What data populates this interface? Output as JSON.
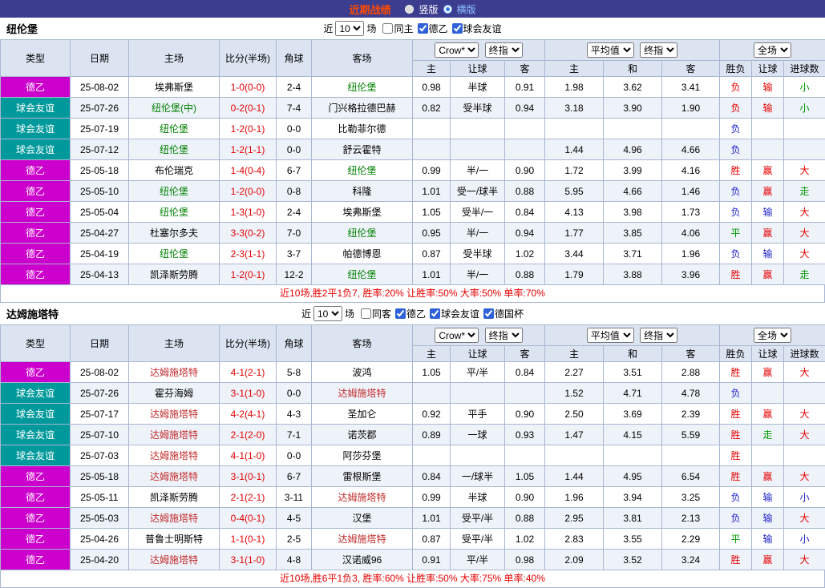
{
  "topbar": {
    "title": "近期战绩",
    "vertical_label": "竖版",
    "horizontal_label": "横版"
  },
  "labels": {
    "near": "近",
    "field": "场"
  },
  "columns": {
    "type": "类型",
    "date": "日期",
    "home": "主场",
    "score": "比分(半场)",
    "corner": "角球",
    "away": "客场",
    "asian_book": "Crow*",
    "asian_final": "终指",
    "asian_home": "主",
    "asian_line": "让球",
    "asian_away": "客",
    "euro_avg": "平均值",
    "euro_final": "终指",
    "euro_home": "主",
    "euro_draw": "和",
    "euro_away": "客",
    "scope": "全场",
    "wdl": "胜负",
    "handicap_result": "让球",
    "goals_result": "进球数"
  },
  "colors": {
    "topbar_bg": "#3d3d8f",
    "title": "#ff4b00",
    "header_bg": "#dce4f2",
    "grid_border": "#aab6d2",
    "row_stripe": "#eef3fa",
    "summary_text": "#e60000"
  },
  "badge_colors": {
    "德乙": "#cc00cc",
    "球会友谊": "#00999b"
  },
  "result_colors": {
    "r": "#e60000",
    "b": "#2222cc",
    "g": "#009900"
  },
  "sections": [
    {
      "team": "纽伦堡",
      "team_color": "#008000",
      "count": "10",
      "filters": [
        {
          "label": "同主",
          "checked": false
        },
        {
          "label": "德乙",
          "checked": true
        },
        {
          "label": "球会友谊",
          "checked": true
        }
      ],
      "rows": [
        {
          "type": "德乙",
          "date": "25-08-02",
          "home": "埃弗斯堡",
          "hh": false,
          "score": "1-0(0-0)",
          "corner": "2-4",
          "away": "纽伦堡",
          "ah": true,
          "a1": "0.98",
          "al": "半球",
          "a2": "0.91",
          "e1": "1.98",
          "ex": "3.62",
          "e2": "3.41",
          "w": "负",
          "wc": "r",
          "h": "输",
          "hc": "r",
          "g": "小",
          "gc": "g"
        },
        {
          "type": "球会友谊",
          "date": "25-07-26",
          "home": "纽伦堡(中)",
          "hh": true,
          "score": "0-2(0-1)",
          "corner": "7-4",
          "away": "门兴格拉德巴赫",
          "ah": false,
          "a1": "0.82",
          "al": "受半球",
          "a2": "0.94",
          "e1": "3.18",
          "ex": "3.90",
          "e2": "1.90",
          "w": "负",
          "wc": "r",
          "h": "输",
          "hc": "r",
          "g": "小",
          "gc": "g"
        },
        {
          "type": "球会友谊",
          "date": "25-07-19",
          "home": "纽伦堡",
          "hh": true,
          "score": "1-2(0-1)",
          "corner": "0-0",
          "away": "比勒菲尔德",
          "ah": false,
          "a1": "",
          "al": "",
          "a2": "",
          "e1": "",
          "ex": "",
          "e2": "",
          "w": "负",
          "wc": "b",
          "h": "",
          "hc": "",
          "g": "",
          "gc": ""
        },
        {
          "type": "球会友谊",
          "date": "25-07-12",
          "home": "纽伦堡",
          "hh": true,
          "score": "1-2(1-1)",
          "corner": "0-0",
          "away": "舒云霍特",
          "ah": false,
          "a1": "",
          "al": "",
          "a2": "",
          "e1": "1.44",
          "ex": "4.96",
          "e2": "4.66",
          "w": "负",
          "wc": "b",
          "h": "",
          "hc": "",
          "g": "",
          "gc": ""
        },
        {
          "type": "德乙",
          "date": "25-05-18",
          "home": "布伦瑞克",
          "hh": false,
          "score": "1-4(0-4)",
          "corner": "6-7",
          "away": "纽伦堡",
          "ah": true,
          "a1": "0.99",
          "al": "半/一",
          "a2": "0.90",
          "e1": "1.72",
          "ex": "3.99",
          "e2": "4.16",
          "w": "胜",
          "wc": "r",
          "h": "赢",
          "hc": "r",
          "g": "大",
          "gc": "r"
        },
        {
          "type": "德乙",
          "date": "25-05-10",
          "home": "纽伦堡",
          "hh": true,
          "score": "1-2(0-0)",
          "corner": "0-8",
          "away": "科隆",
          "ah": false,
          "a1": "1.01",
          "al": "受一/球半",
          "a2": "0.88",
          "e1": "5.95",
          "ex": "4.66",
          "e2": "1.46",
          "w": "负",
          "wc": "b",
          "h": "赢",
          "hc": "r",
          "g": "走",
          "gc": "g"
        },
        {
          "type": "德乙",
          "date": "25-05-04",
          "home": "纽伦堡",
          "hh": true,
          "score": "1-3(1-0)",
          "corner": "2-4",
          "away": "埃弗斯堡",
          "ah": false,
          "a1": "1.05",
          "al": "受半/一",
          "a2": "0.84",
          "e1": "4.13",
          "ex": "3.98",
          "e2": "1.73",
          "w": "负",
          "wc": "b",
          "h": "输",
          "hc": "b",
          "g": "大",
          "gc": "r"
        },
        {
          "type": "德乙",
          "date": "25-04-27",
          "home": "杜塞尔多夫",
          "hh": false,
          "score": "3-3(0-2)",
          "corner": "7-0",
          "away": "纽伦堡",
          "ah": true,
          "a1": "0.95",
          "al": "半/一",
          "a2": "0.94",
          "e1": "1.77",
          "ex": "3.85",
          "e2": "4.06",
          "w": "平",
          "wc": "g",
          "h": "赢",
          "hc": "r",
          "g": "大",
          "gc": "r"
        },
        {
          "type": "德乙",
          "date": "25-04-19",
          "home": "纽伦堡",
          "hh": true,
          "score": "2-3(1-1)",
          "corner": "3-7",
          "away": "帕德博恩",
          "ah": false,
          "a1": "0.87",
          "al": "受半球",
          "a2": "1.02",
          "e1": "3.44",
          "ex": "3.71",
          "e2": "1.96",
          "w": "负",
          "wc": "b",
          "h": "输",
          "hc": "b",
          "g": "大",
          "gc": "r"
        },
        {
          "type": "德乙",
          "date": "25-04-13",
          "home": "凯泽斯劳腾",
          "hh": false,
          "score": "1-2(0-1)",
          "corner": "12-2",
          "away": "纽伦堡",
          "ah": true,
          "a1": "1.01",
          "al": "半/一",
          "a2": "0.88",
          "e1": "1.79",
          "ex": "3.88",
          "e2": "3.96",
          "w": "胜",
          "wc": "r",
          "h": "赢",
          "hc": "r",
          "g": "走",
          "gc": "g"
        }
      ],
      "summary": "近10场,胜2平1负7, 胜率:20% 让胜率:50% 大率:50% 单率:70%"
    },
    {
      "team": "达姆施塔特",
      "team_color": "#c22b2b",
      "count": "10",
      "filters": [
        {
          "label": "同客",
          "checked": false
        },
        {
          "label": "德乙",
          "checked": true
        },
        {
          "label": "球会友谊",
          "checked": true
        },
        {
          "label": "德国杯",
          "checked": true
        }
      ],
      "rows": [
        {
          "type": "德乙",
          "date": "25-08-02",
          "home": "达姆施塔特",
          "hh": true,
          "score": "4-1(2-1)",
          "corner": "5-8",
          "away": "波鸿",
          "ah": false,
          "a1": "1.05",
          "al": "平/半",
          "a2": "0.84",
          "e1": "2.27",
          "ex": "3.51",
          "e2": "2.88",
          "w": "胜",
          "wc": "r",
          "h": "赢",
          "hc": "r",
          "g": "大",
          "gc": "r"
        },
        {
          "type": "球会友谊",
          "date": "25-07-26",
          "home": "霍芬海姆",
          "hh": false,
          "score": "3-1(1-0)",
          "corner": "0-0",
          "away": "达姆施塔特",
          "ah": true,
          "a1": "",
          "al": "",
          "a2": "",
          "e1": "1.52",
          "ex": "4.71",
          "e2": "4.78",
          "w": "负",
          "wc": "b",
          "h": "",
          "hc": "",
          "g": "",
          "gc": ""
        },
        {
          "type": "球会友谊",
          "date": "25-07-17",
          "home": "达姆施塔特",
          "hh": true,
          "score": "4-2(4-1)",
          "corner": "4-3",
          "away": "圣加仑",
          "ah": false,
          "a1": "0.92",
          "al": "平手",
          "a2": "0.90",
          "e1": "2.50",
          "ex": "3.69",
          "e2": "2.39",
          "w": "胜",
          "wc": "r",
          "h": "赢",
          "hc": "r",
          "g": "大",
          "gc": "r"
        },
        {
          "type": "球会友谊",
          "date": "25-07-10",
          "home": "达姆施塔特",
          "hh": true,
          "score": "2-1(2-0)",
          "corner": "7-1",
          "away": "诺茨郡",
          "ah": false,
          "a1": "0.89",
          "al": "一球",
          "a2": "0.93",
          "e1": "1.47",
          "ex": "4.15",
          "e2": "5.59",
          "w": "胜",
          "wc": "r",
          "h": "走",
          "hc": "g",
          "g": "大",
          "gc": "r"
        },
        {
          "type": "球会友谊",
          "date": "25-07-03",
          "home": "达姆施塔特",
          "hh": true,
          "score": "4-1(1-0)",
          "corner": "0-0",
          "away": "阿莎芬堡",
          "ah": false,
          "a1": "",
          "al": "",
          "a2": "",
          "e1": "",
          "ex": "",
          "e2": "",
          "w": "胜",
          "wc": "r",
          "h": "",
          "hc": "",
          "g": "",
          "gc": ""
        },
        {
          "type": "德乙",
          "date": "25-05-18",
          "home": "达姆施塔特",
          "hh": true,
          "score": "3-1(0-1)",
          "corner": "6-7",
          "away": "雷根斯堡",
          "ah": false,
          "a1": "0.84",
          "al": "一/球半",
          "a2": "1.05",
          "e1": "1.44",
          "ex": "4.95",
          "e2": "6.54",
          "w": "胜",
          "wc": "r",
          "h": "赢",
          "hc": "r",
          "g": "大",
          "gc": "r"
        },
        {
          "type": "德乙",
          "date": "25-05-11",
          "home": "凯泽斯劳腾",
          "hh": false,
          "score": "2-1(2-1)",
          "corner": "3-11",
          "away": "达姆施塔特",
          "ah": true,
          "a1": "0.99",
          "al": "半球",
          "a2": "0.90",
          "e1": "1.96",
          "ex": "3.94",
          "e2": "3.25",
          "w": "负",
          "wc": "b",
          "h": "输",
          "hc": "b",
          "g": "小",
          "gc": "b"
        },
        {
          "type": "德乙",
          "date": "25-05-03",
          "home": "达姆施塔特",
          "hh": true,
          "score": "0-4(0-1)",
          "corner": "4-5",
          "away": "汉堡",
          "ah": false,
          "a1": "1.01",
          "al": "受平/半",
          "a2": "0.88",
          "e1": "2.95",
          "ex": "3.81",
          "e2": "2.13",
          "w": "负",
          "wc": "b",
          "h": "输",
          "hc": "b",
          "g": "大",
          "gc": "r"
        },
        {
          "type": "德乙",
          "date": "25-04-26",
          "home": "普鲁士明斯特",
          "hh": false,
          "score": "1-1(0-1)",
          "corner": "2-5",
          "away": "达姆施塔特",
          "ah": true,
          "a1": "0.87",
          "al": "受平/半",
          "a2": "1.02",
          "e1": "2.83",
          "ex": "3.55",
          "e2": "2.29",
          "w": "平",
          "wc": "g",
          "h": "输",
          "hc": "b",
          "g": "小",
          "gc": "b"
        },
        {
          "type": "德乙",
          "date": "25-04-20",
          "home": "达姆施塔特",
          "hh": true,
          "score": "3-1(1-0)",
          "corner": "4-8",
          "away": "汉诺威96",
          "ah": false,
          "a1": "0.91",
          "al": "平/半",
          "a2": "0.98",
          "e1": "2.09",
          "ex": "3.52",
          "e2": "3.24",
          "w": "胜",
          "wc": "r",
          "h": "赢",
          "hc": "r",
          "g": "大",
          "gc": "r"
        }
      ],
      "summary": "近10场,胜6平1负3, 胜率:60% 让胜率:50% 大率:75% 单率:40%"
    }
  ]
}
